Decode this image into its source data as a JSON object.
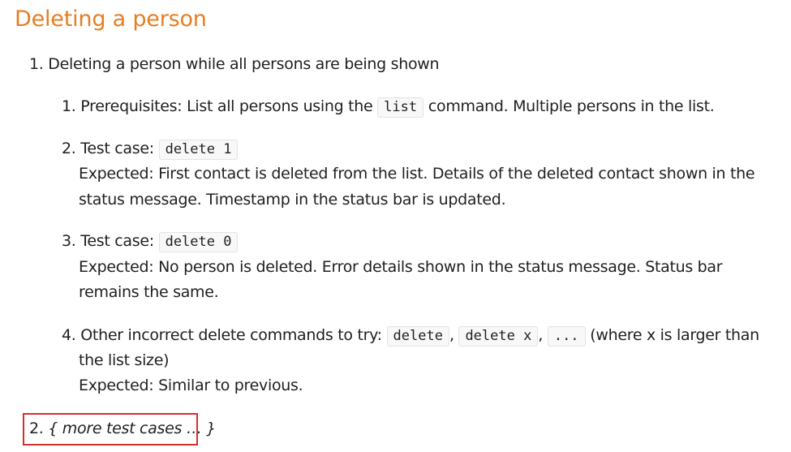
{
  "heading": "Deleting a person",
  "outer_items": [
    {
      "number": "1.",
      "text": "Deleting a person while all persons are being shown"
    },
    {
      "number": "2.",
      "text": "{ more test cases … }"
    }
  ],
  "inner_items": [
    {
      "number": "1.",
      "prefix": "Prerequisites: List all persons using the",
      "code": "list",
      "suffix": "command. Multiple persons in the list."
    },
    {
      "number": "2.",
      "label": "Test case:",
      "code": "delete 1",
      "expected_line1": "Expected: First contact is deleted from the list. Details of the deleted contact shown in the",
      "expected_line2": "status message. Timestamp in the status bar is updated."
    },
    {
      "number": "3.",
      "label": "Test case:",
      "code": "delete 0",
      "expected_line1": "Expected: No person is deleted. Error details shown in the status message. Status bar",
      "expected_line2": "remains the same."
    },
    {
      "number": "4.",
      "prefix": "Other incorrect delete commands to try:",
      "codes": [
        "delete",
        "delete x",
        "..."
      ],
      "suffix": "(where x is larger than",
      "line2": "the list size)",
      "expected": "Expected: Similar to previous."
    }
  ]
}
